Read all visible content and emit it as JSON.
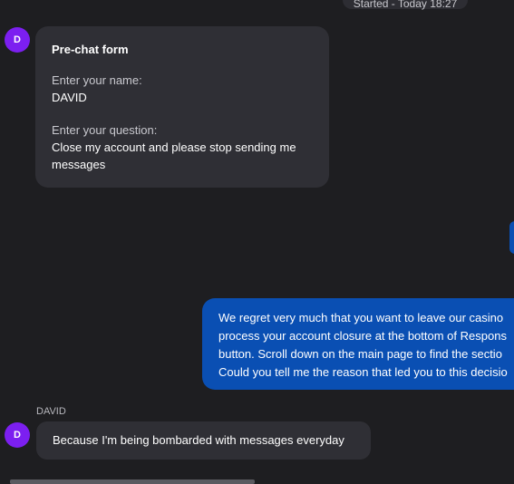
{
  "header": {
    "started_text": "Started - Today 18:27"
  },
  "avatar": {
    "initial": "D"
  },
  "prechat_form": {
    "title": "Pre-chat form",
    "name_label": "Enter your name:",
    "name_value": "DAVID",
    "question_label": "Enter your question:",
    "question_value_lines": [
      "Close my account and please stop sending me",
      "messages"
    ]
  },
  "agent_message": {
    "lines": [
      "We regret very much that you want to leave our casino",
      "process your account closure at the bottom of Respons",
      "button. Scroll down on the main page to find the sectio",
      "Could you tell me the reason that led you to this decisio"
    ]
  },
  "user_message": {
    "sender": "DAVID",
    "text": "Because I'm being bombarded with messages everyday"
  },
  "colors": {
    "background": "#1e1e21",
    "bubble_dark": "#2f2f35",
    "agent_bubble": "#0a4fb3",
    "avatar": "#7c1ff0"
  }
}
